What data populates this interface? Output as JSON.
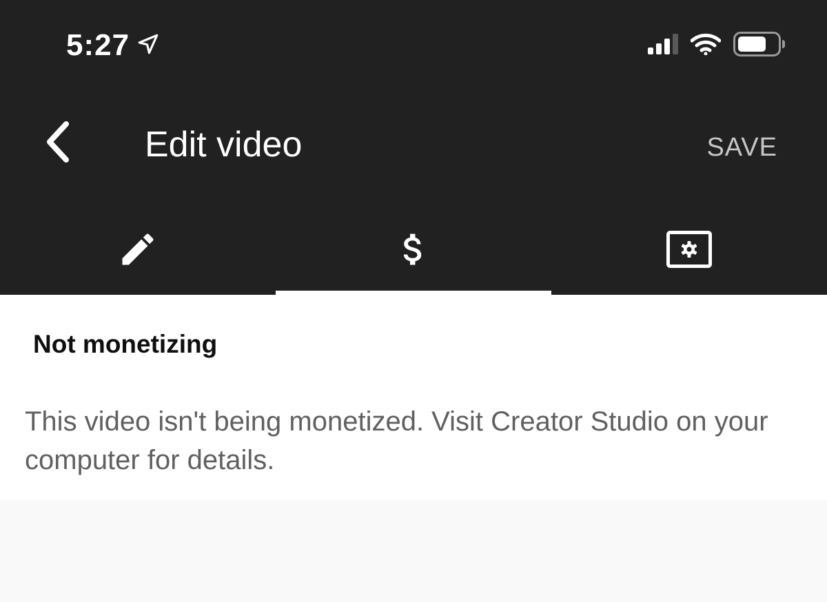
{
  "status_bar": {
    "time": "5:27",
    "icons": [
      "location-arrow-icon",
      "cellular-signal-icon",
      "wifi-icon",
      "battery-icon"
    ]
  },
  "app_bar": {
    "back_icon": "chevron-left-icon",
    "title": "Edit video",
    "save_label": "SAVE"
  },
  "tabs": [
    {
      "icon": "pencil-icon",
      "selected": false
    },
    {
      "icon": "dollar-icon",
      "selected": true
    },
    {
      "icon": "settings-screen-icon",
      "selected": false
    }
  ],
  "monetization": {
    "heading": "Not monetizing",
    "description": "This video isn't being monetized. Visit Creator Studio on your computer for details."
  },
  "colors": {
    "header_bg": "#212121",
    "content_bg": "#ffffff",
    "page_bg": "#f9f9f9",
    "save_text": "#c6c6c6",
    "body_text": "#606060"
  }
}
